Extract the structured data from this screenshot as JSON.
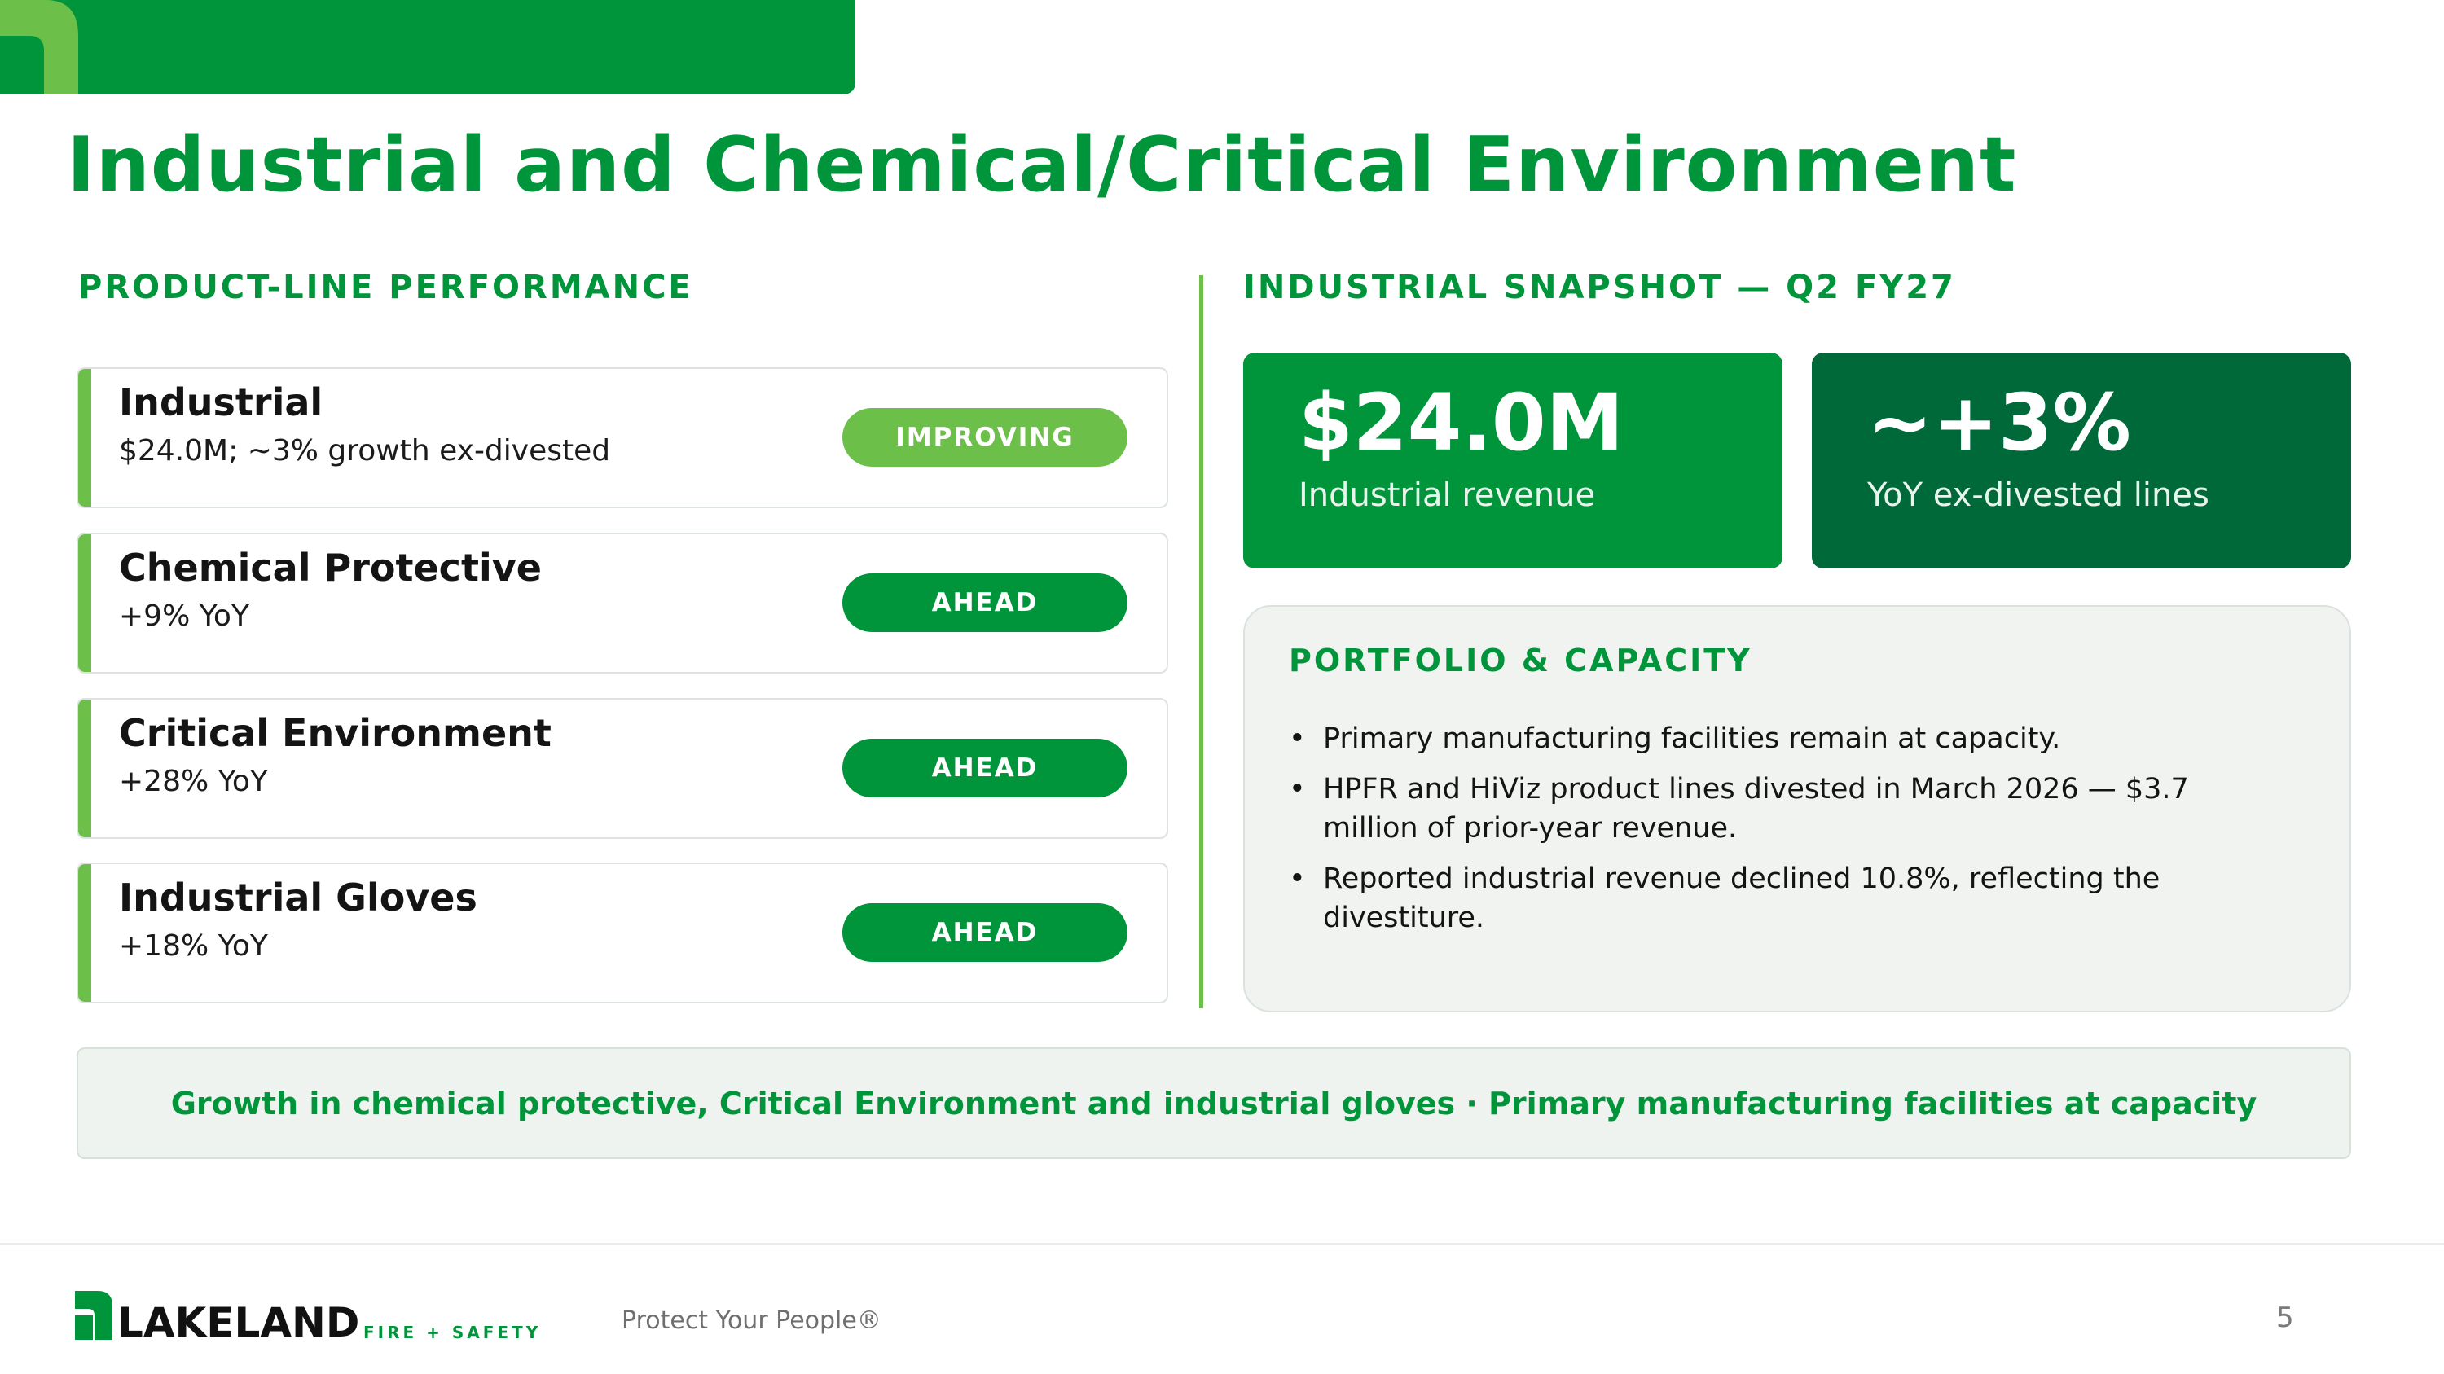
{
  "colors": {
    "brand_green": "#00953b",
    "light_green": "#6cc04a",
    "dark_green": "#00693a",
    "panel_bg": "#f0f3f0"
  },
  "header": {
    "title": "Industrial and Chemical/Critical Environment"
  },
  "product_lines": {
    "heading": "PRODUCT-LINE PERFORMANCE",
    "items": [
      {
        "name": "Industrial",
        "detail": "$24.0M; ~3% growth ex-divested",
        "status": "IMPROVING",
        "status_color": "#6cc04a"
      },
      {
        "name": "Chemical Protective",
        "detail": "+9% YoY",
        "status": "AHEAD",
        "status_color": "#00953b"
      },
      {
        "name": "Critical Environment",
        "detail": "+28% YoY",
        "status": "AHEAD",
        "status_color": "#00953b"
      },
      {
        "name": "Industrial Gloves",
        "detail": "+18% YoY",
        "status": "AHEAD",
        "status_color": "#00953b"
      }
    ]
  },
  "snapshot": {
    "heading": "INDUSTRIAL SNAPSHOT — Q2 FY27",
    "stats": [
      {
        "value": "$24.0M",
        "label": "Industrial revenue",
        "color": "#00953b"
      },
      {
        "value": "~+3%",
        "label": "YoY ex-divested lines",
        "color": "#00693a"
      }
    ]
  },
  "portfolio": {
    "heading": "PORTFOLIO & CAPACITY",
    "bullets": [
      "Primary manufacturing facilities remain at capacity.",
      "HPFR and HiViz product lines divested in March 2026 — $3.7 million of prior-year revenue.",
      "Reported industrial revenue declined 10.8%, reflecting the divestiture."
    ]
  },
  "callout": {
    "text": "Growth in chemical protective, Critical Environment and industrial gloves · Primary manufacturing facilities at capacity"
  },
  "footer": {
    "logo_text": "LAKELAND",
    "logo_subtext": "FIRE + SAFETY",
    "tagline": "Protect Your People®",
    "page_number": "5"
  }
}
